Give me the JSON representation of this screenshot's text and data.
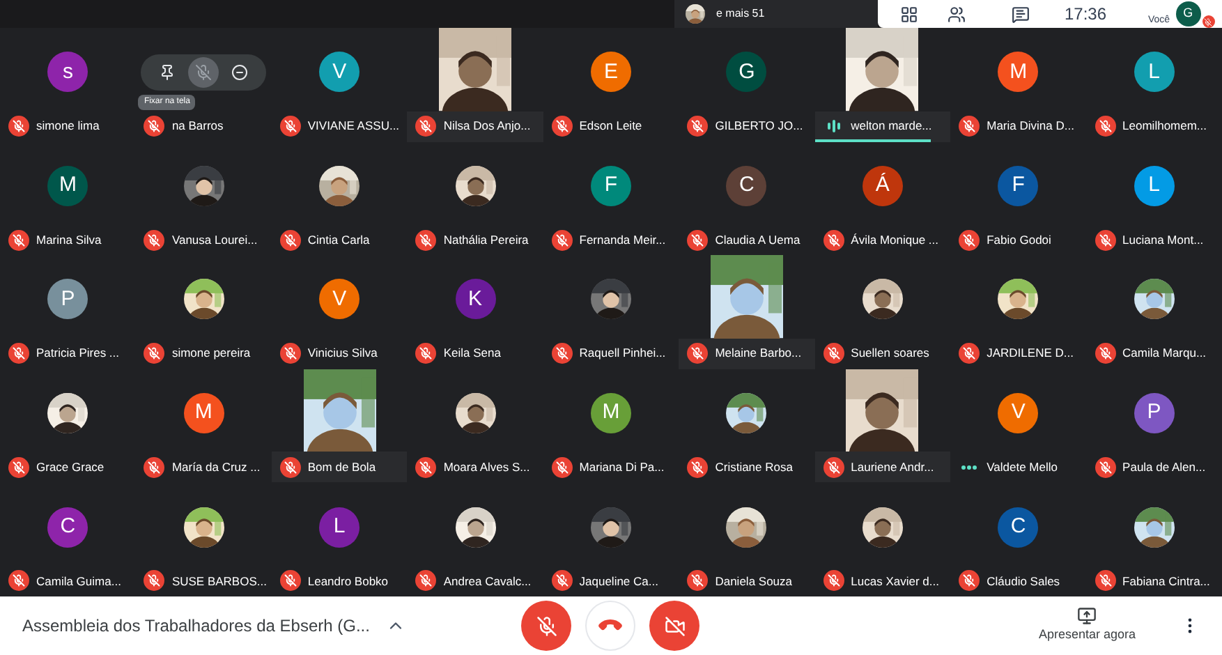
{
  "top_bar": {
    "notification": {
      "text": "e mais 51"
    },
    "time": "17:36",
    "self": {
      "label": "Você",
      "initial": "G",
      "color": "#0d5d4b",
      "muted": true
    }
  },
  "tiles": [
    {
      "kind": "avatar",
      "name": "simone lima",
      "initial": "s",
      "color": "#8e24aa",
      "muted": true,
      "speaking": false
    },
    {
      "kind": "controls",
      "name": "na Barros",
      "tooltip": "Fixar na tela",
      "muted": true,
      "speaking": false
    },
    {
      "kind": "avatar",
      "name": "VIVIANE ASSU...",
      "initial": "V",
      "color": "#129eaf",
      "muted": true,
      "speaking": false
    },
    {
      "kind": "video",
      "name": "Nilsa Dos Anjo...",
      "muted": true,
      "speaking": false
    },
    {
      "kind": "avatar",
      "name": "Edson Leite",
      "initial": "E",
      "color": "#ef6c00",
      "muted": true,
      "speaking": false
    },
    {
      "kind": "avatar",
      "name": "GILBERTO JO...",
      "initial": "G",
      "color": "#004d40",
      "muted": true,
      "speaking": false
    },
    {
      "kind": "video",
      "name": "welton marde...",
      "muted": false,
      "speaking": true
    },
    {
      "kind": "avatar",
      "name": "Maria Divina D...",
      "initial": "M",
      "color": "#f4511e",
      "muted": true,
      "speaking": false
    },
    {
      "kind": "avatar",
      "name": "Leomilhomem...",
      "initial": "L",
      "color": "#129eaf",
      "muted": true,
      "speaking": false
    },
    {
      "kind": "avatar",
      "name": "Marina Silva",
      "initial": "M",
      "color": "#00574b",
      "muted": true,
      "speaking": false
    },
    {
      "name": "Vanusa Lourei...",
      "muted": true,
      "speaking": false
    },
    {
      "name": "Cintia Carla",
      "muted": true,
      "speaking": false
    },
    {
      "name": "Nathália Pereira",
      "muted": true,
      "speaking": false
    },
    {
      "kind": "avatar",
      "name": "Fernanda Meir...",
      "initial": "F",
      "color": "#00897b",
      "muted": true,
      "speaking": false
    },
    {
      "kind": "avatar",
      "name": "Claudia A Uema",
      "initial": "C",
      "color": "#5d4037",
      "muted": true,
      "speaking": false
    },
    {
      "kind": "avatar",
      "name": "Ávila Monique ...",
      "initial": "Á",
      "color": "#bf360c",
      "muted": true,
      "speaking": false
    },
    {
      "kind": "avatar",
      "name": "Fabio Godoi",
      "initial": "F",
      "color": "#0b57a0",
      "muted": true,
      "speaking": false
    },
    {
      "kind": "avatar",
      "name": "Luciana Mont...",
      "initial": "L",
      "color": "#039be5",
      "muted": true,
      "speaking": false
    },
    {
      "kind": "avatar",
      "name": "Patricia Pires ...",
      "initial": "P",
      "color": "#78909c",
      "muted": true,
      "speaking": false
    },
    {
      "name": "simone pereira",
      "muted": true,
      "speaking": false
    },
    {
      "kind": "avatar",
      "name": "Vinicius Silva",
      "initial": "V",
      "color": "#ef6c00",
      "muted": true,
      "speaking": false
    },
    {
      "kind": "avatar",
      "name": "Keila Sena",
      "initial": "K",
      "color": "#6a1b9a",
      "muted": true,
      "speaking": false
    },
    {
      "name": "Raquell Pinhei...",
      "muted": true,
      "speaking": false
    },
    {
      "kind": "video",
      "name": "Melaine Barbo...",
      "muted": true,
      "speaking": false
    },
    {
      "name": "Suellen soares",
      "muted": true,
      "speaking": false
    },
    {
      "name": "JARDILENE D...",
      "muted": true,
      "speaking": false
    },
    {
      "name": "Camila Marqu...",
      "muted": true,
      "speaking": false
    },
    {
      "name": "Grace Grace",
      "muted": true,
      "speaking": false
    },
    {
      "kind": "avatar",
      "name": "María da Cruz ...",
      "initial": "M",
      "color": "#f4511e",
      "muted": true,
      "speaking": false
    },
    {
      "kind": "video",
      "name": "Bom de Bola",
      "muted": true,
      "speaking": false
    },
    {
      "name": "Moara Alves S...",
      "muted": true,
      "speaking": false
    },
    {
      "kind": "avatar",
      "name": "Mariana Di Pa...",
      "initial": "M",
      "color": "#689f38",
      "muted": true,
      "speaking": false
    },
    {
      "name": "Cristiane Rosa",
      "muted": true,
      "speaking": false
    },
    {
      "kind": "video",
      "name": "Lauriene Andr...",
      "muted": true,
      "speaking": false
    },
    {
      "kind": "avatar",
      "name": "Valdete Mello",
      "initial": "V",
      "color": "#ef6c00",
      "muted": false,
      "speaking": false
    },
    {
      "kind": "avatar",
      "name": "Paula de Alen...",
      "initial": "P",
      "color": "#7e57c2",
      "muted": true,
      "speaking": false
    },
    {
      "kind": "avatar",
      "name": "Camila Guima...",
      "initial": "C",
      "color": "#8e24aa",
      "muted": true,
      "speaking": false
    },
    {
      "name": "SUSE BARBOS...",
      "muted": true,
      "speaking": false
    },
    {
      "kind": "avatar",
      "name": "Leandro Bobko",
      "initial": "L",
      "color": "#7b1fa2",
      "muted": true,
      "speaking": false
    },
    {
      "name": "Andrea Cavalc...",
      "muted": true,
      "speaking": false
    },
    {
      "name": "Jaqueline Ca...",
      "muted": true,
      "speaking": false
    },
    {
      "name": "Daniela Souza",
      "muted": true,
      "speaking": false
    },
    {
      "name": "Lucas Xavier d...",
      "muted": true,
      "speaking": false
    },
    {
      "kind": "avatar",
      "name": "Cláudio Sales",
      "initial": "C",
      "color": "#0b57a0",
      "muted": true,
      "speaking": false
    },
    {
      "name": "Fabiana Cintra...",
      "muted": true,
      "speaking": false
    }
  ],
  "bottom_bar": {
    "meeting_title": "Assembleia dos Trabalhadores da Ebserh (G...",
    "controls": [
      {
        "kind": "mic",
        "on": false
      },
      {
        "kind": "hangup"
      },
      {
        "kind": "camera",
        "on": false
      }
    ],
    "present_label": "Apresentar agora"
  }
}
